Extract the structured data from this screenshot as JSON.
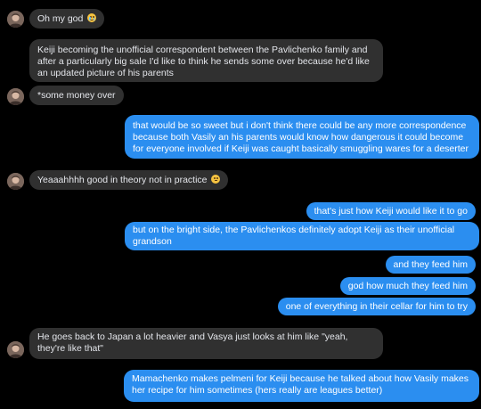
{
  "emojis": {
    "crying": "crying-face",
    "smirk": "sweat-smile-face"
  },
  "colors": {
    "background": "#000000",
    "incoming_bubble": "#303030",
    "outgoing_bubble": "#2b8ef0",
    "incoming_text": "#e4e6eb",
    "outgoing_text": "#ffffff"
  },
  "messages": [
    {
      "text": "Oh my god",
      "emoji": "crying-face"
    },
    {
      "text": "Keiji becoming the unofficial correspondent between the Pavlichenko family and after a particularly big sale I'd like to think he sends some over because he'd like an updated picture of his parents"
    },
    {
      "text": "*some money over"
    },
    {
      "text": "that would be so sweet but i don't think there could be any more correspondence because both Vasily an his parents would know how dangerous it could become for everyone involved if Keiji was caught basically smuggling wares for a deserter"
    },
    {
      "text": "Yeaaahhhh good in theory not in practice",
      "emoji": "sweat-smile-face"
    },
    {
      "text": "that's just how Keiji would like it to go"
    },
    {
      "text": "but on the bright side, the Pavlichenkos definitely adopt Keiji as their unofficial grandson"
    },
    {
      "text": "and they feed him"
    },
    {
      "text": "god how much they feed him"
    },
    {
      "text": "one of everything in their cellar for him to try"
    },
    {
      "text": "He goes back to Japan a lot heavier and Vasya just looks at him like \"yeah, they're like that\""
    },
    {
      "text": "Mamachenko makes pelmeni for Keiji because he talked about how Vasily makes her recipe for him sometimes (hers really are leagues better)"
    }
  ]
}
